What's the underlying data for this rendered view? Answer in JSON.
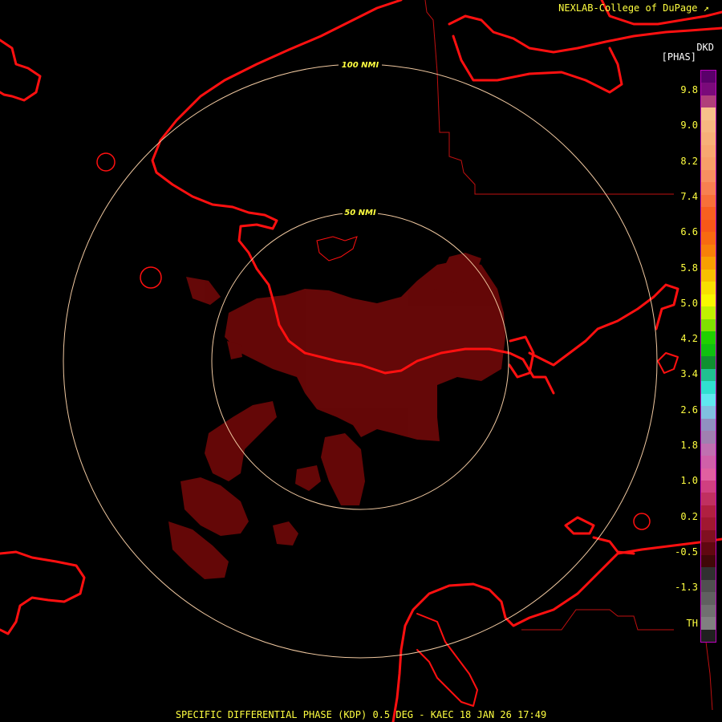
{
  "header": {
    "credit": "NEXLAB-College of DuPage",
    "credit_mark": "↗"
  },
  "product": {
    "code": "DKD",
    "unit": "[PHAS]"
  },
  "footer": {
    "title": "SPECIFIC DIFFERENTIAL PHASE (KDP) 0.5 DEG - KAEC 18 JAN 26 17:49"
  },
  "range_rings": [
    {
      "label": "50 NMI"
    },
    {
      "label": "100 NMI"
    }
  ],
  "legend": {
    "labels": [
      "9.8",
      "9.0",
      "8.2",
      "7.4",
      "6.6",
      "5.8",
      "5.0",
      "4.2",
      "3.4",
      "2.6",
      "1.8",
      "1.0",
      "0.2",
      "-0.5",
      "-1.3",
      "TH"
    ],
    "colors": [
      "#5a006a",
      "#7a0a7a",
      "#b0407a",
      "#f7c08a",
      "#f7b880",
      "#f7b078",
      "#f8a870",
      "#f8a068",
      "#f89060",
      "#f88050",
      "#f87038",
      "#f86020",
      "#f85818",
      "#f86a10",
      "#f88008",
      "#f8a000",
      "#f8c000",
      "#f8e000",
      "#f8f800",
      "#c0f000",
      "#80e000",
      "#20d000",
      "#10c010",
      "#109030",
      "#20c090",
      "#30e0d0",
      "#60e8f0",
      "#80c0e0",
      "#9090c0",
      "#a080b0",
      "#c070b0",
      "#d060a8",
      "#e060a0",
      "#d04080",
      "#c03060",
      "#b02040",
      "#a01830",
      "#801020",
      "#600810",
      "#400808",
      "#303030",
      "#505050",
      "#606060",
      "#707070",
      "#808080",
      "#202020"
    ]
  },
  "map_colors": {
    "coastline": "#ff1010",
    "borders": "#c01010",
    "rings": "#f0c8a0",
    "echo": "#6a0808"
  }
}
